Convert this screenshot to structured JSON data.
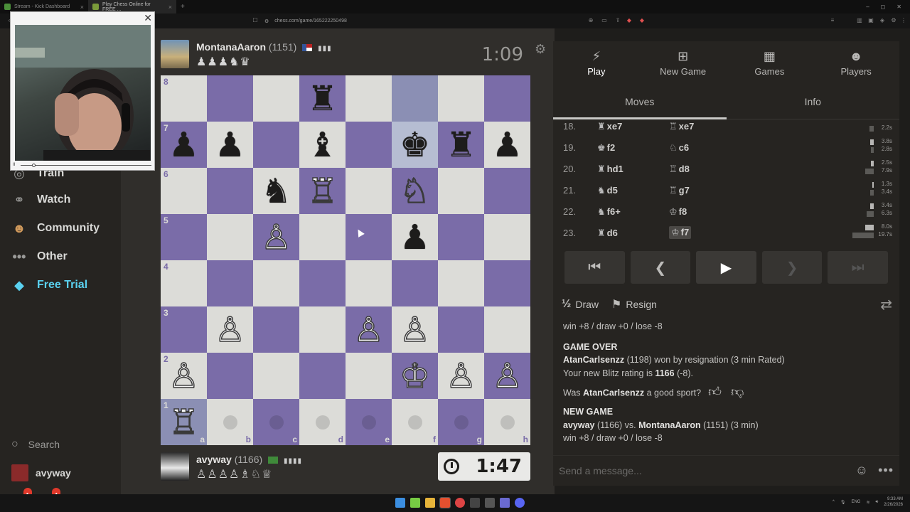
{
  "browser": {
    "tabs": [
      {
        "label": "Stream - Kick Dashboard",
        "active": false
      },
      {
        "label": "Play Chess Online for FREE ...",
        "active": true
      }
    ],
    "url": "chess.com/game/165222250498"
  },
  "sidebar": {
    "items": [
      {
        "label": "Train",
        "icon": "target-icon"
      },
      {
        "label": "Watch",
        "icon": "binoculars-icon"
      },
      {
        "label": "Community",
        "icon": "people-icon"
      },
      {
        "label": "Other",
        "icon": "ellipsis-icon"
      },
      {
        "label": "Free Trial",
        "icon": "diamond-icon"
      }
    ],
    "search_label": "Search",
    "username": "avyway",
    "friends_badge": "1",
    "messages_badge": "4"
  },
  "top_player": {
    "name": "MontanaAaron",
    "rating": "(1151)",
    "captured": "♟♟♟♞♛",
    "clock": "1:09"
  },
  "bottom_player": {
    "name": "avyway",
    "rating": "(1166)",
    "captured": "♙♙♙♙♗♘♕",
    "clock": "1:47"
  },
  "board": {
    "ranks": [
      "8",
      "7",
      "6",
      "5",
      "4",
      "3",
      "2",
      "1"
    ],
    "files": [
      "a",
      "b",
      "c",
      "d",
      "e",
      "f",
      "g",
      "h"
    ],
    "position": [
      [
        "",
        "",
        "",
        "♜",
        "",
        "",
        "",
        ""
      ],
      [
        "♟",
        "♟",
        "",
        "♝",
        "",
        "♚",
        "♜",
        "♟"
      ],
      [
        "",
        "",
        "♞",
        "♖",
        "",
        "♘",
        "",
        ""
      ],
      [
        "",
        "",
        "♙",
        "",
        "",
        "♟",
        "",
        ""
      ],
      [
        "",
        "",
        "",
        "",
        "",
        "",
        "",
        ""
      ],
      [
        "",
        "♙",
        "",
        "",
        "♙",
        "♙",
        "",
        ""
      ],
      [
        "♙",
        "",
        "",
        "",
        "",
        "♔",
        "♙",
        "♙"
      ],
      [
        "♖",
        "",
        "",
        "",
        "",
        "",
        "",
        ""
      ]
    ],
    "colors": [
      [
        "",
        "",
        "",
        "b",
        "",
        "",
        "",
        ""
      ],
      [
        "b",
        "b",
        "",
        "b",
        "",
        "b",
        "b",
        "b"
      ],
      [
        "",
        "",
        "b",
        "w",
        "",
        "w",
        "",
        ""
      ],
      [
        "",
        "",
        "w",
        "",
        "",
        "b",
        "",
        ""
      ],
      [
        "",
        "",
        "",
        "",
        "",
        "",
        "",
        ""
      ],
      [
        "",
        "w",
        "",
        "",
        "w",
        "w",
        "",
        ""
      ],
      [
        "w",
        "",
        "",
        "",
        "",
        "w",
        "w",
        "w"
      ],
      [
        "w",
        "",
        "",
        "",
        "",
        "",
        "",
        ""
      ]
    ],
    "highlight": [
      "f8",
      "f7",
      "a1"
    ],
    "move_dots": [
      "b1",
      "c1",
      "d1",
      "e1",
      "f1",
      "g1",
      "h1"
    ]
  },
  "panel": {
    "nav": [
      {
        "label": "Play",
        "icon": "lightning-icon"
      },
      {
        "label": "New Game",
        "icon": "plus-icon"
      },
      {
        "label": "Games",
        "icon": "board-icon"
      },
      {
        "label": "Players",
        "icon": "players-icon"
      }
    ],
    "subtabs": [
      "Moves",
      "Info"
    ],
    "moves": [
      {
        "no": "18.",
        "w_piece": "♜",
        "w": "xe7",
        "b_piece": "♖",
        "b": "xe7",
        "tw": "",
        "tb": "2.2s",
        "bw": 0,
        "bb": 6
      },
      {
        "no": "19.",
        "w_piece": "♚",
        "w": "f2",
        "b_piece": "♘",
        "b": "c6",
        "tw": "3.8s",
        "tb": "2.8s",
        "bw": 5,
        "bb": 4
      },
      {
        "no": "20.",
        "w_piece": "♜",
        "w": "hd1",
        "b_piece": "♖",
        "b": "d8",
        "tw": "2.5s",
        "tb": "7.9s",
        "bw": 4,
        "bb": 12
      },
      {
        "no": "21.",
        "w_piece": "♞",
        "w": "d5",
        "b_piece": "♖",
        "b": "g7",
        "tw": "1.3s",
        "tb": "3.4s",
        "bw": 2,
        "bb": 5
      },
      {
        "no": "22.",
        "w_piece": "♞",
        "w": "f6+",
        "b_piece": "♔",
        "b": "f8",
        "tw": "3.4s",
        "tb": "6.3s",
        "bw": 5,
        "bb": 10
      },
      {
        "no": "23.",
        "w_piece": "♜",
        "w": "d6",
        "b_piece": "♔",
        "b": "f7",
        "tw": "8.0s",
        "tb": "19.7s",
        "bw": 12,
        "bb": 30
      }
    ],
    "draw_label": "Draw",
    "resign_label": "Resign",
    "chat": {
      "line1": "win +8 / draw +0 / lose -8",
      "game_over": "GAME OVER",
      "winner": "AtanCarlsenzz",
      "result_rest": " (1198) won by resignation (3 min Rated)",
      "rating_pre": "Your new Blitz rating is ",
      "rating_val": "1166",
      "rating_post": " (-8).",
      "sport_pre": "Was ",
      "sport_name": "AtanCarlsenzz",
      "sport_post": " a good sport?",
      "new_game": "NEW GAME",
      "ng_p1": "avyway",
      "ng_mid": " (1166) vs. ",
      "ng_p2": "MontanaAaron",
      "ng_post": " (1151) (3 min)",
      "line_last": "win +8 / draw +0 / lose -8"
    },
    "message_placeholder": "Send a message..."
  },
  "taskbar": {
    "lang": "ENG",
    "time": "9:33 AM",
    "date": "2/26/2026"
  }
}
